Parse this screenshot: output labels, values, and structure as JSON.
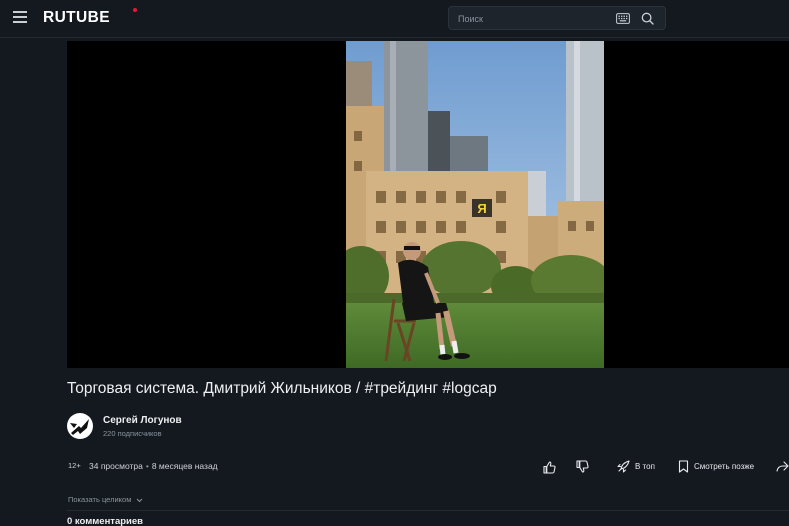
{
  "header": {
    "logo_text": "RUTUBE",
    "search": {
      "placeholder": "Поиск",
      "value": ""
    }
  },
  "video": {
    "title": "Торговая система. Дмитрий Жильников / #трейдинг #logcap",
    "building_sign": "Я"
  },
  "channel": {
    "name": "Сергей Логунов",
    "subscribers": "220 подписчиков"
  },
  "meta": {
    "age_rating": "12+",
    "views": "34 просмотра",
    "published": "8 месяцев назад"
  },
  "actions": {
    "to_top": "В топ",
    "watch_later": "Смотреть позже"
  },
  "description": {
    "show_full": "Показать целиком"
  },
  "comments": {
    "count_label": "0 комментариев"
  },
  "colors": {
    "background": "#14191f",
    "accent": "#ed143b"
  }
}
